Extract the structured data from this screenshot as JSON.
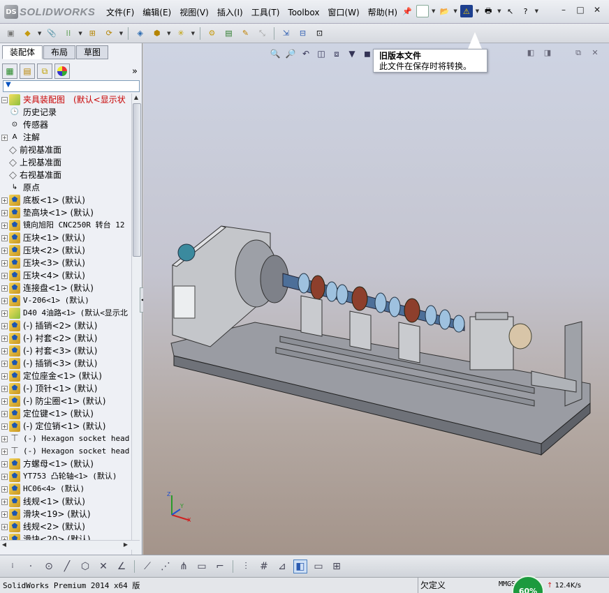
{
  "app": {
    "logo_text": "SOLIDWORKS",
    "logo_mark": "DS"
  },
  "menus": [
    "文件(F)",
    "编辑(E)",
    "视图(V)",
    "插入(I)",
    "工具(T)",
    "Toolbox",
    "窗口(W)",
    "帮助(H)"
  ],
  "panel": {
    "tabs": [
      "装配体",
      "布局",
      "草图"
    ],
    "filter_icon": "funnel-icon",
    "tree": [
      {
        "label": "夹具装配图　(默认<显示状",
        "icon": "assembly-icon",
        "expand": "minus",
        "red": true
      },
      {
        "label": "历史记录",
        "icon": "history-icon",
        "expand": ""
      },
      {
        "label": "传感器",
        "icon": "sensor-icon",
        "expand": ""
      },
      {
        "label": "注解",
        "icon": "annotation-icon",
        "expand": "plus"
      },
      {
        "label": "前视基准面",
        "icon": "plane-icon",
        "expand": ""
      },
      {
        "label": "上视基准面",
        "icon": "plane-icon",
        "expand": ""
      },
      {
        "label": "右视基准面",
        "icon": "plane-icon",
        "expand": ""
      },
      {
        "label": "原点",
        "icon": "origin-icon",
        "expand": ""
      },
      {
        "label": "底板<1> (默认)",
        "icon": "part-icon",
        "expand": "plus"
      },
      {
        "label": "垫高块<1> (默认)",
        "icon": "part-icon",
        "expand": "plus"
      },
      {
        "label": "镜向旭阳 CNC250R 转台 12",
        "icon": "part-icon",
        "expand": "plus"
      },
      {
        "label": "压块<1> (默认)",
        "icon": "part-icon",
        "expand": "plus"
      },
      {
        "label": "压块<2> (默认)",
        "icon": "part-icon",
        "expand": "plus"
      },
      {
        "label": "压块<3> (默认)",
        "icon": "part-icon",
        "expand": "plus"
      },
      {
        "label": "压块<4> (默认)",
        "icon": "part-icon",
        "expand": "plus"
      },
      {
        "label": "连接盘<1> (默认)",
        "icon": "part-icon",
        "expand": "plus"
      },
      {
        "label": "V-206<1> (默认)",
        "icon": "part-icon",
        "expand": "plus"
      },
      {
        "label": "D40 4油路<1> (默认<显示北",
        "icon": "subassembly-icon",
        "expand": "plus"
      },
      {
        "label": "(-) 插销<2> (默认)",
        "icon": "part-icon",
        "expand": "plus"
      },
      {
        "label": "(-) 衬套<2> (默认)",
        "icon": "part-icon",
        "expand": "plus"
      },
      {
        "label": "(-) 衬套<3> (默认)",
        "icon": "part-icon",
        "expand": "plus"
      },
      {
        "label": "(-) 插销<3> (默认)",
        "icon": "part-icon",
        "expand": "plus"
      },
      {
        "label": "定位座金<1> (默认)",
        "icon": "part-icon",
        "expand": "plus"
      },
      {
        "label": "(-) 顶针<1> (默认)",
        "icon": "part-icon",
        "expand": "plus"
      },
      {
        "label": "(-) 防尘圈<1> (默认)",
        "icon": "part-icon",
        "expand": "plus"
      },
      {
        "label": "定位键<1> (默认)",
        "icon": "part-icon",
        "expand": "plus"
      },
      {
        "label": "(-) 定位销<1> (默认)",
        "icon": "part-icon",
        "expand": "plus"
      },
      {
        "label": "(-) Hexagon socket head",
        "icon": "screw-icon",
        "expand": "plus"
      },
      {
        "label": "(-) Hexagon socket head",
        "icon": "screw-icon",
        "expand": "plus"
      },
      {
        "label": "方螺母<1> (默认)",
        "icon": "part-icon",
        "expand": "plus"
      },
      {
        "label": "YT753 凸轮轴<1> (默认)",
        "icon": "part-icon",
        "expand": "plus"
      },
      {
        "label": "HC06<4> (默认)",
        "icon": "part-icon",
        "expand": "plus"
      },
      {
        "label": "线规<1> (默认)",
        "icon": "part-icon",
        "expand": "plus"
      },
      {
        "label": "滑块<19> (默认)",
        "icon": "part-icon",
        "expand": "plus"
      },
      {
        "label": "线规<2> (默认)",
        "icon": "part-icon",
        "expand": "plus"
      },
      {
        "label": "滑块<20> (默认)",
        "icon": "part-icon",
        "expand": "plus"
      }
    ]
  },
  "callout": {
    "title": "旧版本文件",
    "body": "此文件在保存时将转换。"
  },
  "status": {
    "product": "SolidWorks Premium 2014 x64 版",
    "state": "欠定义",
    "units": "MMGS",
    "cpu": "60%",
    "net": "12.4K/s"
  },
  "triad": {
    "x": "X",
    "y": "Y",
    "z": "Z"
  }
}
